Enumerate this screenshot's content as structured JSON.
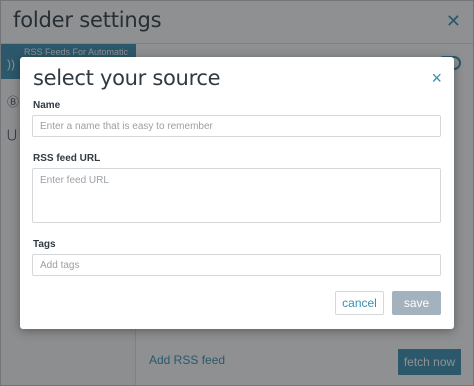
{
  "background": {
    "title": "folder settings",
    "sidebar_active_label": "RSS Feeds For Automatic",
    "add_feed_link": "Add RSS feed",
    "fetch_button": "fetch now"
  },
  "modal": {
    "title": "select your source",
    "close_icon": "×",
    "name": {
      "label": "Name",
      "placeholder": "Enter a name that is easy to remember",
      "value": ""
    },
    "url": {
      "label": "RSS feed URL",
      "placeholder": "Enter feed URL",
      "value": ""
    },
    "tags": {
      "label": "Tags",
      "placeholder": "Add tags",
      "value": ""
    },
    "cancel_label": "cancel",
    "save_label": "save"
  },
  "colors": {
    "accent": "#3a8fb0",
    "disabled": "#a3b2bc",
    "text": "#2f3a43"
  },
  "icons": [
    "close-icon",
    "rss-icon",
    "bitcoin-icon",
    "magnet-icon"
  ]
}
